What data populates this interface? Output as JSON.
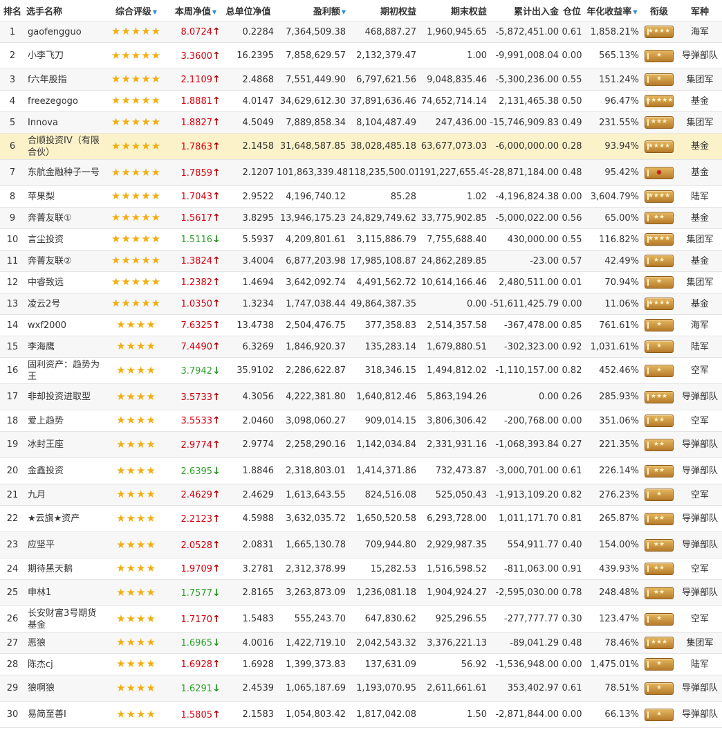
{
  "headers": {
    "rank": "排名",
    "name": "选手名称",
    "rating": "综合评级",
    "week_nav": "本周净值",
    "unit_nav": "总单位净值",
    "profit": "盈利额",
    "start_equity": "期初权益",
    "end_equity": "期末权益",
    "cum_flow": "累计出入金",
    "position": "仓位",
    "annual": "年化收益率",
    "rank_title": "衔级",
    "army": "军种"
  },
  "sorted_columns": [
    "rating",
    "week_nav",
    "profit",
    "annual"
  ],
  "colors": {
    "up": "#d7000f",
    "down": "#2da12a",
    "star": "#f2ae0f",
    "highlight": "#fbf2c9"
  },
  "icons": {
    "up": "up-arrow-icon",
    "down": "down-arrow-icon",
    "star": "star-icon",
    "badge": "rank-badge-icon",
    "sort": "sort-triangle-icon"
  },
  "rows": [
    {
      "rank": "1",
      "name": "gaofengguo",
      "stars": "★★★★★",
      "week_nav": "8.0724",
      "dir": "up",
      "unit_nav": "0.2284",
      "profit": "7,364,509.38",
      "start_equity": "468,887.27",
      "end_equity": "1,960,945.65",
      "cum_flow": "-5,872,451.00",
      "position": "0.61",
      "annual": "1,858.21%",
      "badge": "★★★★",
      "army": "海军"
    },
    {
      "rank": "2",
      "name": "小李飞刀",
      "stars": "★★★★★",
      "week_nav": "3.3600",
      "dir": "up",
      "unit_nav": "16.2395",
      "profit": "7,858,629.57",
      "start_equity": "2,132,379.47",
      "end_equity": "1.00",
      "cum_flow": "-9,991,008.04",
      "position": "0.00",
      "annual": "565.13%",
      "badge": "★",
      "army": "导弹部队"
    },
    {
      "rank": "3",
      "name": "f六年股指",
      "stars": "★★★★★",
      "week_nav": "2.1109",
      "dir": "up",
      "unit_nav": "2.4868",
      "profit": "7,551,449.90",
      "start_equity": "6,797,621.56",
      "end_equity": "9,048,835.46",
      "cum_flow": "-5,300,236.00",
      "position": "0.55",
      "annual": "151.24%",
      "badge": "★",
      "army": "集团军"
    },
    {
      "rank": "4",
      "name": "freezegogo",
      "stars": "★★★★★",
      "week_nav": "1.8881",
      "dir": "up",
      "unit_nav": "4.0147",
      "profit": "34,629,612.30",
      "start_equity": "37,891,636.46",
      "end_equity": "74,652,714.14",
      "cum_flow": "2,131,465.38",
      "position": "0.50",
      "annual": "96.47%",
      "badge": "★★★★★",
      "army": "基金"
    },
    {
      "rank": "5",
      "name": "Innova",
      "stars": "★★★★★",
      "week_nav": "1.8827",
      "dir": "up",
      "unit_nav": "4.5049",
      "profit": "7,889,858.34",
      "start_equity": "8,104,487.49",
      "end_equity": "247,436.00",
      "cum_flow": "-15,746,909.83",
      "position": "0.49",
      "annual": "231.55%",
      "badge": "★★★",
      "army": "集团军"
    },
    {
      "rank": "6",
      "name": "合顺投资IV（有限合伙）",
      "stars": "★★★★★",
      "week_nav": "1.7863",
      "dir": "up",
      "unit_nav": "2.1458",
      "profit": "31,648,587.85",
      "start_equity": "38,028,485.18",
      "end_equity": "63,677,073.03",
      "cum_flow": "-6,000,000.00",
      "position": "0.28",
      "annual": "93.94%",
      "badge": "★★★★",
      "army": "基金"
    },
    {
      "rank": "7",
      "name": "东航金融种子一号",
      "stars": "★★★★★",
      "week_nav": "1.7859",
      "dir": "up",
      "unit_nav": "2.1207",
      "profit": "101,863,339.48",
      "start_equity": "118,235,500.01",
      "end_equity": "191,227,655.49",
      "cum_flow": "-28,871,184.00",
      "position": "0.48",
      "annual": "95.42%",
      "badge": "✸",
      "army": "基金"
    },
    {
      "rank": "8",
      "name": "苹果梨",
      "stars": "★★★★★",
      "week_nav": "1.7043",
      "dir": "up",
      "unit_nav": "2.9522",
      "profit": "4,196,740.12",
      "start_equity": "85.28",
      "end_equity": "1.02",
      "cum_flow": "-4,196,824.38",
      "position": "0.00",
      "annual": "3,604.79%",
      "badge": "★★★★",
      "army": "陆军"
    },
    {
      "rank": "9",
      "name": "奔菁友联①",
      "stars": "★★★★★",
      "week_nav": "1.5617",
      "dir": "up",
      "unit_nav": "3.8295",
      "profit": "13,946,175.23",
      "start_equity": "24,829,749.62",
      "end_equity": "33,775,902.85",
      "cum_flow": "-5,000,022.00",
      "position": "0.56",
      "annual": "65.00%",
      "badge": "★★",
      "army": "基金"
    },
    {
      "rank": "10",
      "name": "言尘投资",
      "stars": "★★★★★",
      "week_nav": "1.5116",
      "dir": "down",
      "unit_nav": "5.5937",
      "profit": "4,209,801.61",
      "start_equity": "3,115,886.79",
      "end_equity": "7,755,688.40",
      "cum_flow": "430,000.00",
      "position": "0.55",
      "annual": "116.82%",
      "badge": "★★★★",
      "army": "集团军"
    },
    {
      "rank": "11",
      "name": "奔菁友联②",
      "stars": "★★★★★",
      "week_nav": "1.3824",
      "dir": "up",
      "unit_nav": "3.4004",
      "profit": "6,877,203.98",
      "start_equity": "17,985,108.87",
      "end_equity": "24,862,289.85",
      "cum_flow": "-23.00",
      "position": "0.57",
      "annual": "42.49%",
      "badge": "★★",
      "army": "基金"
    },
    {
      "rank": "12",
      "name": "中睿致远",
      "stars": "★★★★★",
      "week_nav": "1.2382",
      "dir": "up",
      "unit_nav": "1.4694",
      "profit": "3,642,092.74",
      "start_equity": "4,491,562.72",
      "end_equity": "10,614,166.46",
      "cum_flow": "2,480,511.00",
      "position": "0.01",
      "annual": "70.94%",
      "badge": "★",
      "army": "集团军"
    },
    {
      "rank": "13",
      "name": "凌云2号",
      "stars": "★★★★★",
      "week_nav": "1.0350",
      "dir": "up",
      "unit_nav": "1.3234",
      "profit": "1,747,038.44",
      "start_equity": "49,864,387.35",
      "end_equity": "0.00",
      "cum_flow": "-51,611,425.79",
      "position": "0.00",
      "annual": "11.06%",
      "badge": "★★★★",
      "army": "基金"
    },
    {
      "rank": "14",
      "name": "wxf2000",
      "stars": "★★★★",
      "week_nav": "7.6325",
      "dir": "up",
      "unit_nav": "13.4738",
      "profit": "2,504,476.75",
      "start_equity": "377,358.83",
      "end_equity": "2,514,357.58",
      "cum_flow": "-367,478.00",
      "position": "0.85",
      "annual": "761.61%",
      "badge": "★",
      "army": "海军"
    },
    {
      "rank": "15",
      "name": "李海鹰",
      "stars": "★★★★",
      "week_nav": "7.4490",
      "dir": "up",
      "unit_nav": "6.3269",
      "profit": "1,846,920.37",
      "start_equity": "135,283.14",
      "end_equity": "1,679,880.51",
      "cum_flow": "-302,323.00",
      "position": "0.92",
      "annual": "1,031.61%",
      "badge": "★",
      "army": "陆军"
    },
    {
      "rank": "16",
      "name": "固利资产：趋势为王",
      "stars": "★★★★",
      "week_nav": "3.7942",
      "dir": "down",
      "unit_nav": "35.9102",
      "profit": "2,286,622.87",
      "start_equity": "318,346.15",
      "end_equity": "1,494,812.02",
      "cum_flow": "-1,110,157.00",
      "position": "0.82",
      "annual": "452.46%",
      "badge": "★",
      "army": "空军"
    },
    {
      "rank": "17",
      "name": "非却投资进取型",
      "stars": "★★★★",
      "week_nav": "3.5733",
      "dir": "up",
      "unit_nav": "4.3056",
      "profit": "4,222,381.80",
      "start_equity": "1,640,812.46",
      "end_equity": "5,863,194.26",
      "cum_flow": "0.00",
      "position": "0.26",
      "annual": "285.93%",
      "badge": "★★★",
      "army": "导弹部队"
    },
    {
      "rank": "18",
      "name": "爱上趋势",
      "stars": "★★★★",
      "week_nav": "3.5533",
      "dir": "up",
      "unit_nav": "2.0460",
      "profit": "3,098,060.27",
      "start_equity": "909,014.15",
      "end_equity": "3,806,306.42",
      "cum_flow": "-200,768.00",
      "position": "0.00",
      "annual": "351.06%",
      "badge": "★★",
      "army": "空军"
    },
    {
      "rank": "19",
      "name": "冰封王座",
      "stars": "★★★★",
      "week_nav": "2.9774",
      "dir": "up",
      "unit_nav": "2.9774",
      "profit": "2,258,290.16",
      "start_equity": "1,142,034.84",
      "end_equity": "2,331,931.16",
      "cum_flow": "-1,068,393.84",
      "position": "0.27",
      "annual": "221.35%",
      "badge": "★★",
      "army": "导弹部队"
    },
    {
      "rank": "20",
      "name": "金鑫投资",
      "stars": "★★★★",
      "week_nav": "2.6395",
      "dir": "down",
      "unit_nav": "1.8846",
      "profit": "2,318,803.01",
      "start_equity": "1,414,371.86",
      "end_equity": "732,473.87",
      "cum_flow": "-3,000,701.00",
      "position": "0.61",
      "annual": "226.14%",
      "badge": "★★",
      "army": "导弹部队"
    },
    {
      "rank": "21",
      "name": "九月",
      "stars": "★★★★",
      "week_nav": "2.4629",
      "dir": "up",
      "unit_nav": "2.4629",
      "profit": "1,613,643.55",
      "start_equity": "824,516.08",
      "end_equity": "525,050.43",
      "cum_flow": "-1,913,109.20",
      "position": "0.82",
      "annual": "276.23%",
      "badge": "★",
      "army": "空军"
    },
    {
      "rank": "22",
      "name": "★云旗★资产",
      "stars": "★★★★",
      "week_nav": "2.2123",
      "dir": "up",
      "unit_nav": "4.5988",
      "profit": "3,632,035.72",
      "start_equity": "1,650,520.58",
      "end_equity": "6,293,728.00",
      "cum_flow": "1,011,171.70",
      "position": "0.81",
      "annual": "265.87%",
      "badge": "★★",
      "army": "导弹部队"
    },
    {
      "rank": "23",
      "name": "应坚平",
      "stars": "★★★★",
      "week_nav": "2.0528",
      "dir": "up",
      "unit_nav": "2.0831",
      "profit": "1,665,130.78",
      "start_equity": "709,944.80",
      "end_equity": "2,929,987.35",
      "cum_flow": "554,911.77",
      "position": "0.40",
      "annual": "154.00%",
      "badge": "★★",
      "army": "导弹部队"
    },
    {
      "rank": "24",
      "name": "期待黑天鹅",
      "stars": "★★★★",
      "week_nav": "1.9709",
      "dir": "up",
      "unit_nav": "3.2781",
      "profit": "2,312,378.99",
      "start_equity": "15,282.53",
      "end_equity": "1,516,598.52",
      "cum_flow": "-811,063.00",
      "position": "0.91",
      "annual": "439.93%",
      "badge": "★★",
      "army": "空军"
    },
    {
      "rank": "25",
      "name": "申林1",
      "stars": "★★★★",
      "week_nav": "1.7577",
      "dir": "down",
      "unit_nav": "2.8165",
      "profit": "3,263,873.09",
      "start_equity": "1,236,081.18",
      "end_equity": "1,904,924.27",
      "cum_flow": "-2,595,030.00",
      "position": "0.78",
      "annual": "248.48%",
      "badge": "★★",
      "army": "导弹部队"
    },
    {
      "rank": "26",
      "name": "长安财富3号期货基金",
      "stars": "★★★★",
      "week_nav": "1.7170",
      "dir": "up",
      "unit_nav": "1.5483",
      "profit": "555,243.70",
      "start_equity": "647,830.62",
      "end_equity": "925,296.55",
      "cum_flow": "-277,777.77",
      "position": "0.30",
      "annual": "123.47%",
      "badge": "★",
      "army": "空军"
    },
    {
      "rank": "27",
      "name": "恶狼",
      "stars": "★★★★",
      "week_nav": "1.6965",
      "dir": "down",
      "unit_nav": "4.0016",
      "profit": "1,422,719.10",
      "start_equity": "2,042,543.32",
      "end_equity": "3,376,221.13",
      "cum_flow": "-89,041.29",
      "position": "0.48",
      "annual": "78.46%",
      "badge": "★★★",
      "army": "集团军"
    },
    {
      "rank": "28",
      "name": "陈杰cj",
      "stars": "★★★★",
      "week_nav": "1.6928",
      "dir": "up",
      "unit_nav": "1.6928",
      "profit": "1,399,373.83",
      "start_equity": "137,631.09",
      "end_equity": "56.92",
      "cum_flow": "-1,536,948.00",
      "position": "0.00",
      "annual": "1,475.01%",
      "badge": "★",
      "army": "陆军"
    },
    {
      "rank": "29",
      "name": "狼啊狼",
      "stars": "★★★★",
      "week_nav": "1.6291",
      "dir": "down",
      "unit_nav": "2.4539",
      "profit": "1,065,187.69",
      "start_equity": "1,193,070.95",
      "end_equity": "2,611,661.61",
      "cum_flow": "353,402.97",
      "position": "0.61",
      "annual": "78.51%",
      "badge": "★",
      "army": "导弹部队"
    },
    {
      "rank": "30",
      "name": "易简至善I",
      "stars": "★★★★",
      "week_nav": "1.5805",
      "dir": "up",
      "unit_nav": "2.1583",
      "profit": "1,054,803.42",
      "start_equity": "1,817,042.08",
      "end_equity": "1.50",
      "cum_flow": "-2,871,844.00",
      "position": "0.00",
      "annual": "66.13%",
      "badge": "★",
      "army": "导弹部队"
    }
  ]
}
